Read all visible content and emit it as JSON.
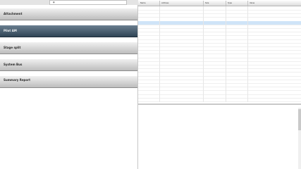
{
  "topbar": {
    "search_placeholder": ""
  },
  "groups": [
    {
      "name": "Attachment",
      "c1": "",
      "c1v": "",
      "c2": "",
      "c2v": ""
    },
    {
      "name": "Pilot AM",
      "c1": "",
      "c1v": "",
      "c2": "",
      "c2v": ""
    },
    {
      "name": "Stage split",
      "c1": "",
      "c1v": "",
      "c2": "",
      "c2v": ""
    },
    {
      "name": "System Bus",
      "c1": "",
      "c1v": "",
      "c2": "",
      "c2v": ""
    },
    {
      "name": "Summary Report",
      "c1": "",
      "c1v": "",
      "c2": "",
      "c2v": ""
    }
  ],
  "table": {
    "headers": [
      "Name",
      "Address",
      "Size",
      "Type",
      "Value"
    ],
    "rows": [
      {
        "name": "",
        "addr": "",
        "size": "",
        "type": "",
        "val": ""
      },
      {
        "name": "",
        "addr": "",
        "size": "",
        "type": "",
        "val": ""
      },
      {
        "name": "",
        "addr": "",
        "size": "",
        "type": "",
        "val": ""
      },
      {
        "name": "",
        "addr": "",
        "size": "",
        "type": "",
        "val": ""
      },
      {
        "name": "",
        "addr": "",
        "size": "",
        "type": "",
        "val": ""
      },
      {
        "name": "",
        "addr": "",
        "size": "",
        "type": "",
        "val": ""
      },
      {
        "name": "",
        "addr": "",
        "size": "",
        "type": "",
        "val": ""
      },
      {
        "name": "",
        "addr": "",
        "size": "",
        "type": "",
        "val": ""
      },
      {
        "name": "",
        "addr": "",
        "size": "",
        "type": "",
        "val": ""
      },
      {
        "name": "",
        "addr": "",
        "size": "",
        "type": "",
        "val": ""
      },
      {
        "name": "",
        "addr": "",
        "size": "",
        "type": "",
        "val": ""
      },
      {
        "name": "",
        "addr": "",
        "size": "",
        "type": "",
        "val": ""
      },
      {
        "name": "",
        "addr": "",
        "size": "",
        "type": "",
        "val": ""
      },
      {
        "name": "",
        "addr": "",
        "size": "",
        "type": "",
        "val": ""
      },
      {
        "name": "",
        "addr": "",
        "size": "",
        "type": "",
        "val": ""
      },
      {
        "name": "",
        "addr": "",
        "size": "",
        "type": "",
        "val": ""
      },
      {
        "name": "",
        "addr": "",
        "size": "",
        "type": "",
        "val": ""
      },
      {
        "name": "",
        "addr": "",
        "size": "",
        "type": "",
        "val": ""
      },
      {
        "name": "",
        "addr": "",
        "size": "",
        "type": "",
        "val": ""
      },
      {
        "name": "",
        "addr": "",
        "size": "",
        "type": "",
        "val": ""
      },
      {
        "name": "",
        "addr": "",
        "size": "",
        "type": "",
        "val": ""
      },
      {
        "name": "",
        "addr": "",
        "size": "",
        "type": "",
        "val": ""
      },
      {
        "name": "",
        "addr": "",
        "size": "",
        "type": "",
        "val": ""
      },
      {
        "name": "",
        "addr": "",
        "size": "",
        "type": "",
        "val": ""
      },
      {
        "name": "",
        "addr": "",
        "size": "",
        "type": "",
        "val": ""
      },
      {
        "name": "",
        "addr": "",
        "size": "",
        "type": "",
        "val": ""
      }
    ]
  },
  "detail": {
    "title": "",
    "para1": "",
    "para2": "",
    "heading": "",
    "sub": "",
    "code1": "",
    "code2": "",
    "code3": "",
    "code4": ""
  }
}
